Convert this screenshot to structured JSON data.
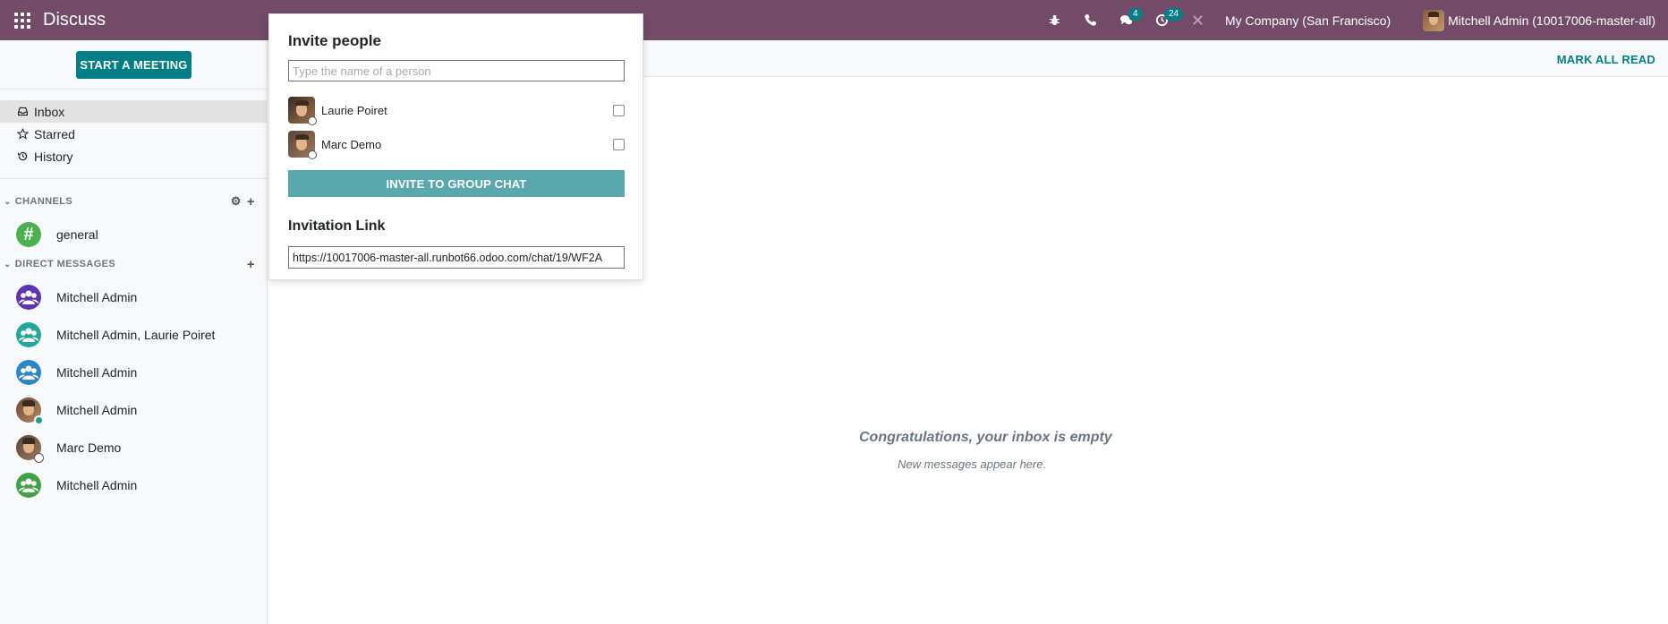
{
  "navbar": {
    "app_title": "Discuss",
    "icons": [
      "apps-grid-icon",
      "bug-icon",
      "phone-icon",
      "chat-icon",
      "activity-icon",
      "close-icon"
    ],
    "messages_badge": "4",
    "activity_badge": "24",
    "company": "My Company (San Francisco)",
    "user_name": "Mitchell Admin (10017006-master-all)"
  },
  "controlbar": {
    "mark_all_read": "MARK ALL READ"
  },
  "sidebar": {
    "start_meeting": "START A MEETING",
    "mailboxes": [
      {
        "label": "Inbox",
        "icon": "inbox-icon",
        "active": true
      },
      {
        "label": "Starred",
        "icon": "star-icon",
        "active": false
      },
      {
        "label": "History",
        "icon": "history-icon",
        "active": false
      }
    ],
    "channels_header": "CHANNELS",
    "channels": [
      {
        "label": "general",
        "icon": "hash-icon"
      }
    ],
    "dm_header": "DIRECT MESSAGES",
    "direct_messages": [
      {
        "label": "Mitchell Admin",
        "avatar": "group-avatar",
        "color": "#5e35b1"
      },
      {
        "label": "Mitchell Admin, Laurie Poiret",
        "avatar": "group-avatar",
        "color": "#26a69a"
      },
      {
        "label": "Mitchell Admin",
        "avatar": "group-avatar",
        "color": "#2e86c1"
      },
      {
        "label": "Mitchell Admin",
        "avatar": "photo-avatar",
        "status": "online"
      },
      {
        "label": "Marc Demo",
        "avatar": "photo-avatar",
        "status": "offline"
      },
      {
        "label": "Mitchell Admin",
        "avatar": "group-avatar",
        "color": "#43a047"
      }
    ]
  },
  "main": {
    "empty_title": "Congratulations, your inbox is empty",
    "empty_subtitle": "New messages appear here."
  },
  "invite_popover": {
    "title": "Invite people",
    "search_placeholder": "Type the name of a person",
    "people": [
      {
        "name": "Laurie Poiret",
        "checked": false
      },
      {
        "name": "Marc Demo",
        "checked": false
      }
    ],
    "invite_button": "INVITE TO GROUP CHAT",
    "link_title": "Invitation Link",
    "link_value": "https://10017006-master-all.runbot66.odoo.com/chat/19/WF2A"
  },
  "colors": {
    "navbar": "#714B67",
    "accent": "#017e84",
    "invite_button": "#5aa8ae"
  }
}
